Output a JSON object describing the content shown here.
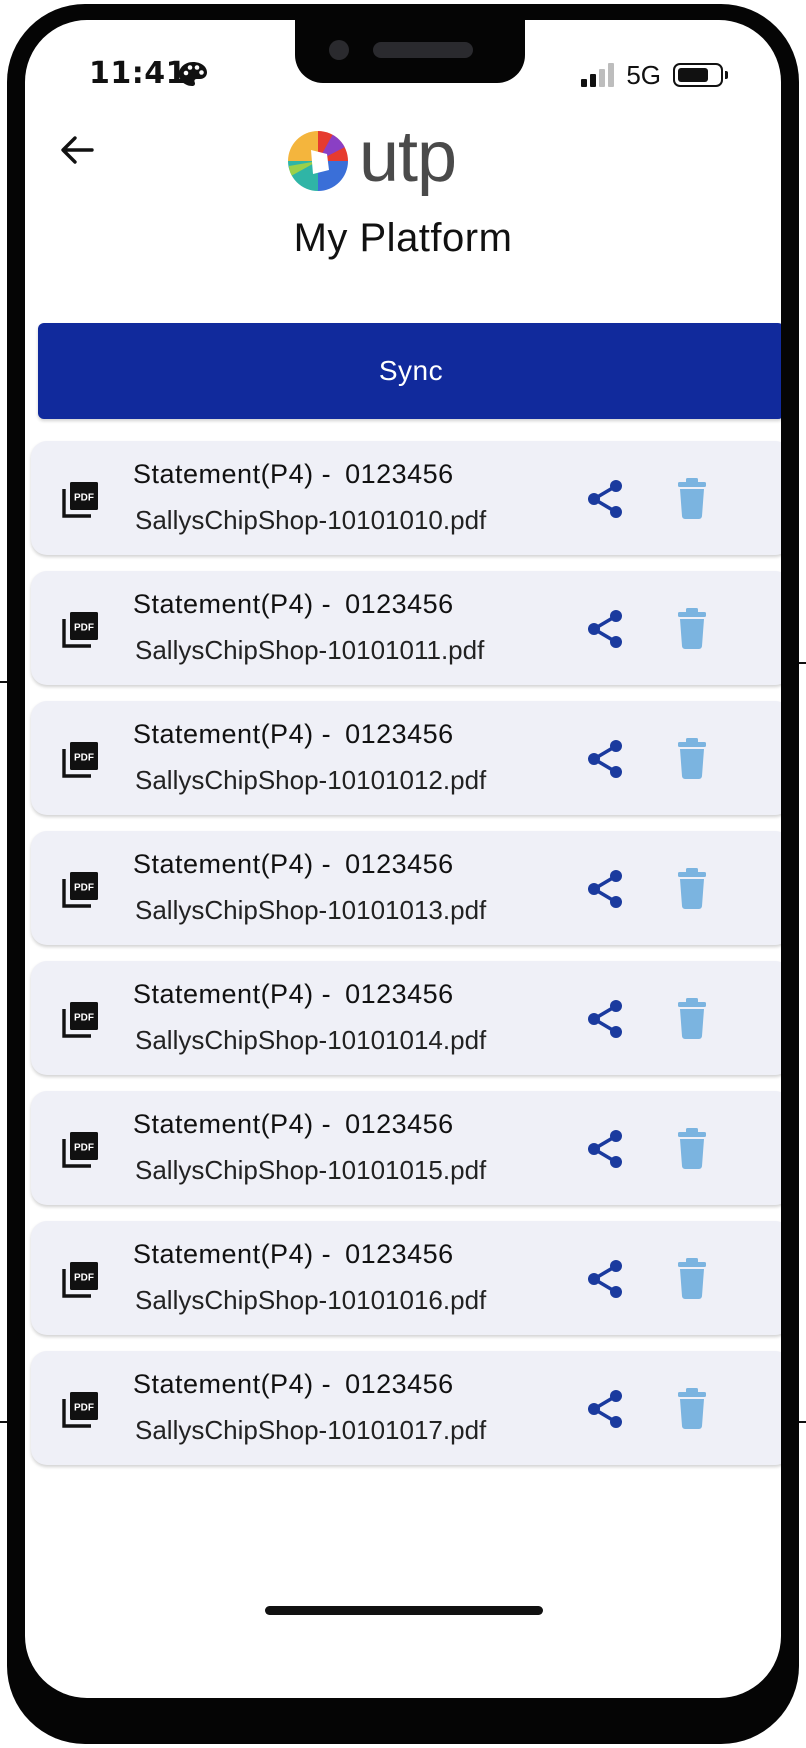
{
  "status_bar": {
    "time": "11:41",
    "network": "5G"
  },
  "header": {
    "logo_text": "utp",
    "title": "My Platform"
  },
  "actions": {
    "sync_label": "Sync"
  },
  "files": [
    {
      "title": "Statement(P4) -",
      "reference": "0123456",
      "filename": "SallysChipShop-10101010.pdf"
    },
    {
      "title": "Statement(P4) -",
      "reference": "0123456",
      "filename": "SallysChipShop-10101011.pdf"
    },
    {
      "title": "Statement(P4) -",
      "reference": "0123456",
      "filename": "SallysChipShop-10101012.pdf"
    },
    {
      "title": "Statement(P4) -",
      "reference": "0123456",
      "filename": "SallysChipShop-10101013.pdf"
    },
    {
      "title": "Statement(P4) -",
      "reference": "0123456",
      "filename": "SallysChipShop-10101014.pdf"
    },
    {
      "title": "Statement(P4) -",
      "reference": "0123456",
      "filename": "SallysChipShop-10101015.pdf"
    },
    {
      "title": "Statement(P4) -",
      "reference": "0123456",
      "filename": "SallysChipShop-10101016.pdf"
    },
    {
      "title": "Statement(P4) -",
      "reference": "0123456",
      "filename": "SallysChipShop-10101017.pdf"
    }
  ],
  "icons": {
    "back": "arrow-left-icon",
    "pdf": "pdf-file-icon",
    "share": "share-icon",
    "delete": "trash-icon",
    "status_emoji": "palette-icon"
  },
  "colors": {
    "primary": "#112a9c",
    "share_icon": "#1a3a9e",
    "delete_icon": "#7bb4e0",
    "row_background": "#eff0f7"
  }
}
